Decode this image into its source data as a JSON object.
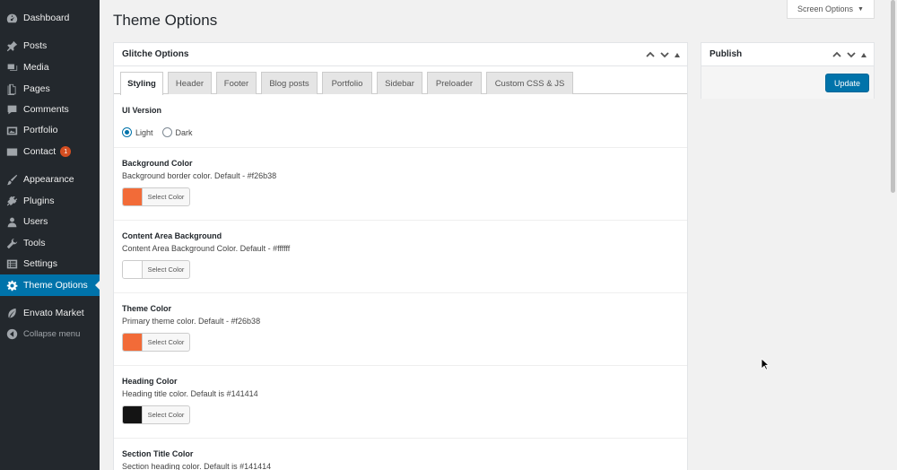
{
  "sidebar": {
    "items": [
      {
        "label": "Dashboard",
        "icon": "dashboard-icon"
      },
      {
        "label": "Posts",
        "icon": "pin-icon"
      },
      {
        "label": "Media",
        "icon": "media-icon"
      },
      {
        "label": "Pages",
        "icon": "page-icon"
      },
      {
        "label": "Comments",
        "icon": "comment-icon"
      },
      {
        "label": "Portfolio",
        "icon": "portfolio-icon"
      },
      {
        "label": "Contact",
        "icon": "mail-icon",
        "badge": "1"
      },
      {
        "label": "Appearance",
        "icon": "brush-icon"
      },
      {
        "label": "Plugins",
        "icon": "plugin-icon"
      },
      {
        "label": "Users",
        "icon": "user-icon"
      },
      {
        "label": "Tools",
        "icon": "wrench-icon"
      },
      {
        "label": "Settings",
        "icon": "settings-icon"
      },
      {
        "label": "Theme Options",
        "icon": "gear-icon",
        "active": true
      },
      {
        "label": "Envato Market",
        "icon": "leaf-icon"
      },
      {
        "label": "Collapse menu",
        "icon": "collapse-icon"
      }
    ]
  },
  "header": {
    "title": "Theme Options",
    "screen_options": "Screen Options"
  },
  "main_box": {
    "title": "Glitche Options",
    "tabs": [
      "Styling",
      "Header",
      "Footer",
      "Blog posts",
      "Portfolio",
      "Sidebar",
      "Preloader",
      "Custom CSS & JS"
    ],
    "active_tab": "Styling",
    "ui_version": {
      "title": "UI Version",
      "options": [
        "Light",
        "Dark"
      ],
      "selected": "Light"
    },
    "color_sections": [
      {
        "title": "Background Color",
        "desc": "Background border color. Default - #f26b38",
        "color": "#f26b38",
        "button": "Select Color"
      },
      {
        "title": "Content Area Background",
        "desc": "Content Area Background Color. Default - #ffffff",
        "color": "#ffffff",
        "button": "Select Color"
      },
      {
        "title": "Theme Color",
        "desc": "Primary theme color. Default - #f26b38",
        "color": "#f26b38",
        "button": "Select Color"
      },
      {
        "title": "Heading Color",
        "desc": "Heading title color. Default is #141414",
        "color": "#141414",
        "button": "Select Color"
      },
      {
        "title": "Section Title Color",
        "desc": "Section heading color. Default is #141414"
      }
    ]
  },
  "publish_box": {
    "title": "Publish",
    "update_label": "Update"
  },
  "colors": {
    "sidebar_bg": "#23282d",
    "accent": "#0073aa",
    "badge": "#d54e21"
  }
}
